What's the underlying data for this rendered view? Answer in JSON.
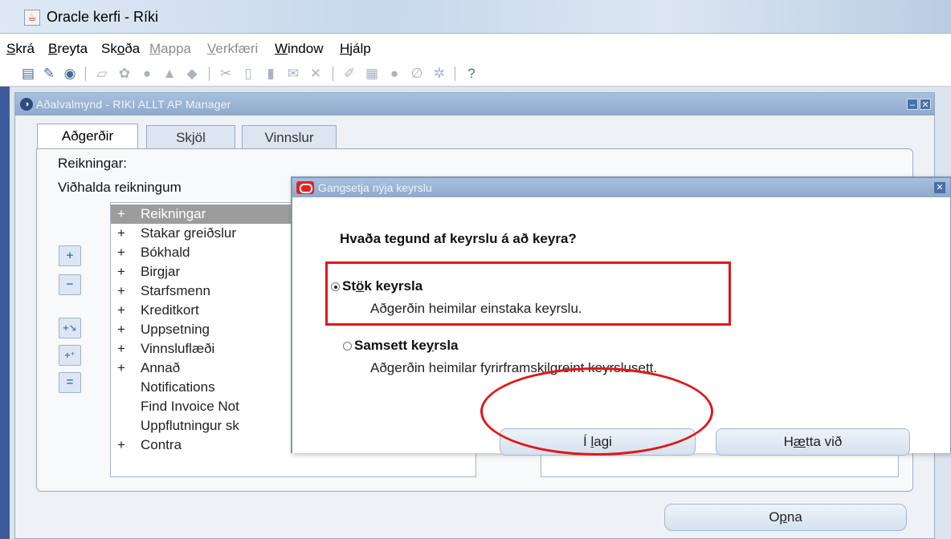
{
  "app": {
    "title": "Oracle kerfi - Ríki"
  },
  "menu": [
    {
      "pre": "",
      "acc": "S",
      "post": "krá",
      "disabled": false
    },
    {
      "pre": "",
      "acc": "B",
      "post": "reyta",
      "disabled": false
    },
    {
      "pre": "Sk",
      "acc": "o",
      "post": "ða",
      "disabled": false
    },
    {
      "pre": "",
      "acc": "M",
      "post": "appa",
      "disabled": true
    },
    {
      "pre": "",
      "acc": "V",
      "post": "erkfæri",
      "disabled": true
    },
    {
      "pre": "",
      "acc": "W",
      "post": "indow",
      "disabled": false
    },
    {
      "pre": "",
      "acc": "H",
      "post": "jálp",
      "disabled": false
    }
  ],
  "toolbar": {
    "help_symbol": "?"
  },
  "navigator": {
    "title": "Aðalvalmynd - RIKI ALLT AP Manager",
    "tabs": [
      "Aðgerðir",
      "Skjöl",
      "Vinnslur"
    ],
    "section_label": "Reikningar:",
    "subsection_label": "Viðhalda reikningum",
    "functions": [
      {
        "prefix": "+",
        "label": "Reikningar",
        "selected": true
      },
      {
        "prefix": "+",
        "label": "Stakar greiðslur",
        "selected": false
      },
      {
        "prefix": "+",
        "label": "Bókhald",
        "selected": false
      },
      {
        "prefix": "+",
        "label": "Birgjar",
        "selected": false
      },
      {
        "prefix": "+",
        "label": "Starfsmenn",
        "selected": false
      },
      {
        "prefix": "+",
        "label": "Kreditkort",
        "selected": false
      },
      {
        "prefix": "+",
        "label": "Uppsetning",
        "selected": false
      },
      {
        "prefix": "+",
        "label": "Vinnsluflæði",
        "selected": false
      },
      {
        "prefix": "+",
        "label": "Annað",
        "selected": false
      },
      {
        "prefix": "",
        "label": "Notifications",
        "selected": false
      },
      {
        "prefix": "",
        "label": "Find Invoice Not",
        "selected": false
      },
      {
        "prefix": "",
        "label": "Uppflutningur sk",
        "selected": false
      },
      {
        "prefix": "+",
        "label": "Contra",
        "selected": false
      }
    ],
    "side_buttons": [
      "+",
      "−",
      "+↘",
      "+⁺",
      "="
    ],
    "open_button": {
      "pre": "O",
      "acc": "p",
      "post": "na"
    }
  },
  "dialog": {
    "title": "Gangsetja nýja keyrslu",
    "question": "Hvaða tegund af keyrslu á að keyra?",
    "options": [
      {
        "pre": "St",
        "acc": "ö",
        "post": "k keyrsla",
        "description": "Aðgerðin heimilar einstaka keyrslu.",
        "selected": true
      },
      {
        "pre": "Samsett ke",
        "acc": "y",
        "post": "rsla",
        "description": "Aðgerðin heimilar fyrirframskilgreint keyrslusett.",
        "selected": false
      }
    ],
    "ok_button": {
      "pre": "Í ",
      "acc": "l",
      "post": "agi"
    },
    "cancel_button": {
      "pre": "H",
      "acc": "æ",
      "post": "tta við"
    }
  },
  "colors": {
    "annotation": "#e01818",
    "window_title_bg": "#9fb8da",
    "selected_row": "#9c9c9c"
  }
}
